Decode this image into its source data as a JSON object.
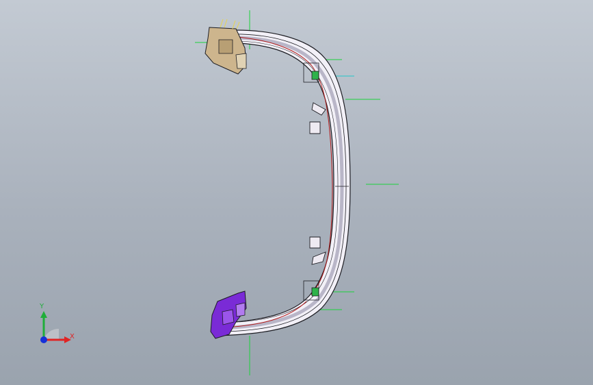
{
  "viewport": {
    "background_top": "#c3cad3",
    "background_bottom": "#9aa3ae",
    "model": {
      "part_main_color": "#f2f0f7",
      "part_shade_color": "#b9b6c8",
      "edge_color": "#1c1c22",
      "trim_line_color": "#b01818",
      "top_bracket_color": "#cdb58d",
      "bottom_bracket_color": "#7a2bd6",
      "clip_color": "#2fb24a",
      "reference_line_color": "#1bd23b"
    }
  },
  "triad": {
    "y_label": "Y",
    "x_label": "X",
    "y_color": "#1fae3a",
    "x_color": "#e02424",
    "z_color": "#1630d8",
    "icon": "axis-triad-icon"
  }
}
